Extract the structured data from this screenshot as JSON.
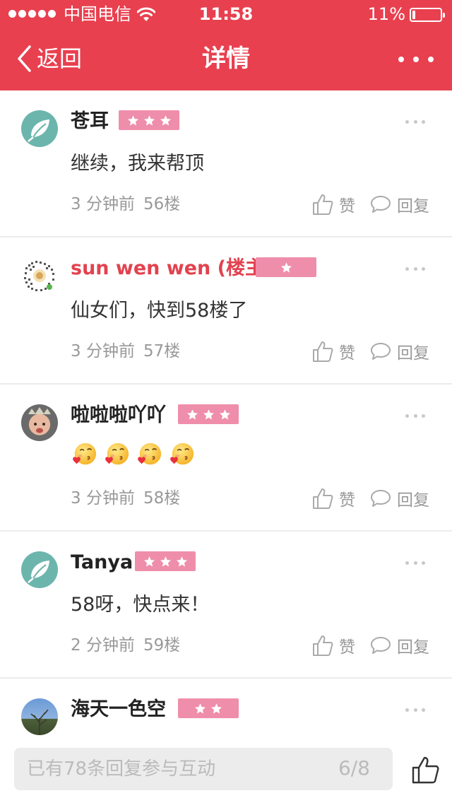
{
  "status_bar": {
    "carrier": "中国电信",
    "time": "11:58",
    "battery_percent": "11%",
    "battery_level": 0.11
  },
  "nav": {
    "back_label": "返回",
    "title": "详情"
  },
  "theme": {
    "brand_red": "#e8404f",
    "badge_pink": "#ef8eaa",
    "host_name_red": "#e2424f"
  },
  "posts": [
    {
      "name": "苍耳",
      "avatar": "leaf-avatar",
      "stars": 3,
      "content": "继续，我来帮顶",
      "time": "3 分钟前",
      "floor": "56楼",
      "like_label": "赞",
      "reply_label": "回复"
    },
    {
      "name": "sun wen wen (楼主)",
      "avatar": "qr-avatar",
      "stars": 1,
      "content": "仙女们，快到58楼了",
      "time": "3 分钟前",
      "floor": "57楼",
      "like_label": "赞",
      "reply_label": "回复"
    },
    {
      "name": "啦啦啦吖吖",
      "avatar": "baby-photo-avatar",
      "stars": 3,
      "content_emojis": [
        "kiss-heart-emoji",
        "kiss-heart-emoji",
        "kiss-heart-emoji",
        "kiss-heart-emoji"
      ],
      "time": "3 分钟前",
      "floor": "58楼",
      "like_label": "赞",
      "reply_label": "回复"
    },
    {
      "name": "Tanya",
      "avatar": "leaf-avatar",
      "stars": 3,
      "content": "58呀，快点来！",
      "time": "2 分钟前",
      "floor": "59楼",
      "like_label": "赞",
      "reply_label": "回复"
    },
    {
      "name": "海天一色空",
      "avatar": "sky-photo-avatar",
      "stars": 2
    }
  ],
  "bottom_bar": {
    "reply_placeholder": "已有78条回复参与互动",
    "page_indicator": "6/8"
  }
}
